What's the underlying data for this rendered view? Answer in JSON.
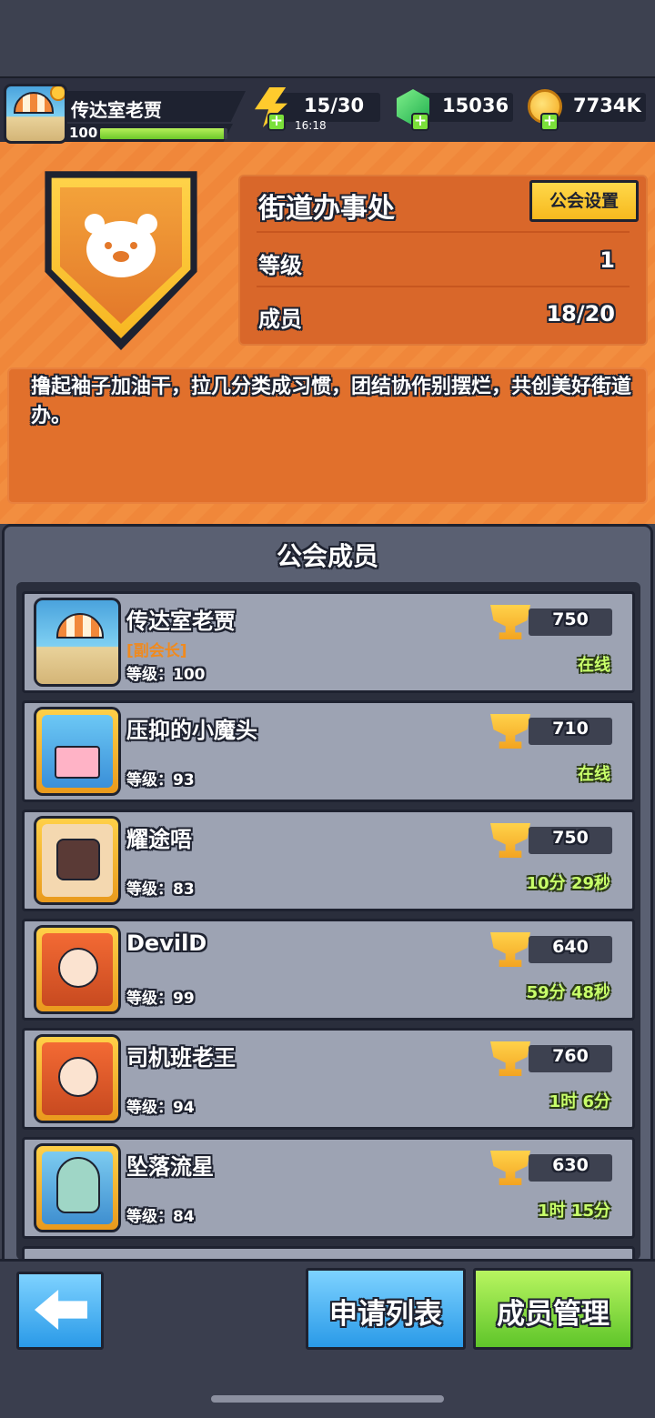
{
  "player": {
    "name": "传达室老贾",
    "level": "100",
    "xp_fraction": 0.97
  },
  "resources": {
    "energy": "15/30",
    "energy_timer": "16:18",
    "gems": "15036",
    "coins": "7734K"
  },
  "guild": {
    "name": "街道办事处",
    "settings_label": "公会设置",
    "level_label": "等级",
    "level_value": "1",
    "members_label": "成员",
    "members_value": "18/20",
    "description": "撸起袖子加油干，拉几分类成习惯，团结协作别摆烂，共创美好街道办。"
  },
  "members_title": "公会成员",
  "members": [
    {
      "name": "传达室老贾",
      "role": "[副会长]",
      "level": "等级：100",
      "trophies": "750",
      "status": "在线",
      "avatar": "beach-umbrella-avatar"
    },
    {
      "name": "压抑的小魔头",
      "role": "",
      "level": "等级：93",
      "trophies": "710",
      "status": "在线",
      "avatar": "birthday-cake-avatar"
    },
    {
      "name": "耀途唔",
      "role": "",
      "level": "等级：83",
      "trophies": "750",
      "status": "10分 29秒",
      "avatar": "masked-character-avatar"
    },
    {
      "name": "DevilD",
      "role": "",
      "level": "等级：99",
      "trophies": "640",
      "status": "59分 48秒",
      "avatar": "red-hair-character-avatar"
    },
    {
      "name": "司机班老王",
      "role": "",
      "level": "等级：94",
      "trophies": "760",
      "status": "1时 6分",
      "avatar": "red-hair-character-avatar"
    },
    {
      "name": "坠落流星",
      "role": "",
      "level": "等级：84",
      "trophies": "630",
      "status": "1时 15分",
      "avatar": "squid-character-avatar"
    }
  ],
  "buttons": {
    "apply_list": "申请列表",
    "member_manage": "成员管理"
  },
  "colors": {
    "guild_orange": "#f0873a",
    "panel_slate": "#5a6072",
    "online_green": "#c8ff6a",
    "accent_gold": "#ffd34a"
  }
}
